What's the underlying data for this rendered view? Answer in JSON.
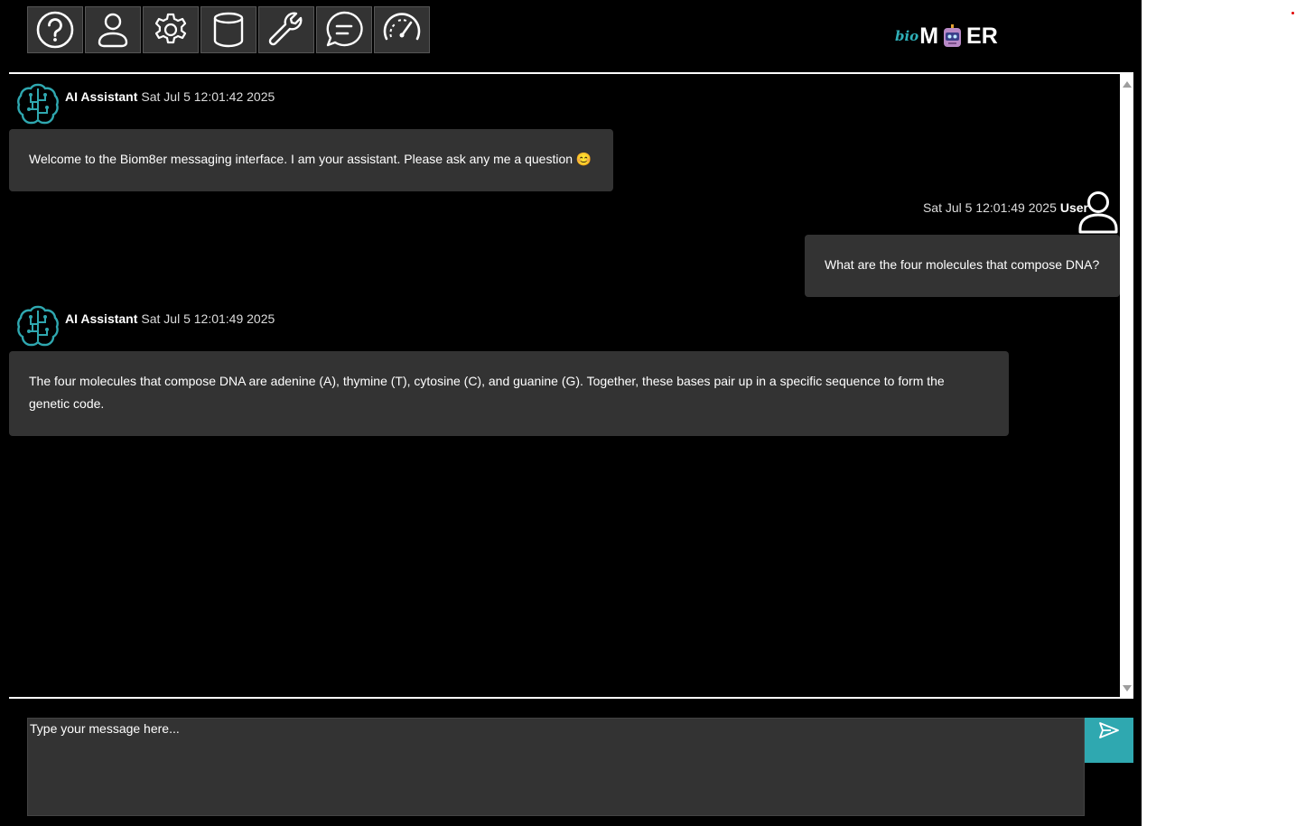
{
  "toolbar": {
    "icons": [
      "help-icon",
      "user-icon",
      "gear-icon",
      "database-icon",
      "wrench-icon",
      "chat-bubble-icon",
      "speedometer-icon"
    ]
  },
  "logo": {
    "prefix": "bio",
    "part1": "M",
    "part2": "ER"
  },
  "messages": [
    {
      "sender": "AI Assistant",
      "timestamp": "Sat Jul 5 12:01:42 2025",
      "text": "Welcome to the Biom8er messaging interface. I am your assistant. Please ask any me a question 😊"
    },
    {
      "sender": "User",
      "timestamp": "Sat Jul 5 12:01:49 2025",
      "text": "What are the four molecules that compose DNA?"
    },
    {
      "sender": "AI Assistant",
      "timestamp": "Sat Jul 5 12:01:49 2025",
      "text": "The four molecules that compose DNA are adenine (A), thymine (T), cytosine (C), and guanine (G). Together, these bases pair up in a specific sequence to form the genetic code."
    }
  ],
  "input": {
    "placeholder": "Type your message here..."
  },
  "colors": {
    "accent": "#2fa8b0",
    "bubble": "#333333",
    "background": "#000000"
  }
}
